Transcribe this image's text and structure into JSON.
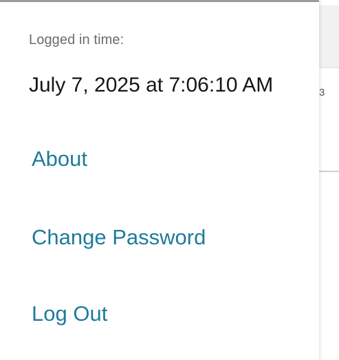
{
  "background": {
    "partial_glyph": "3"
  },
  "user_menu": {
    "login_label": "Logged in time:",
    "login_time": "July 7, 2025 at 7:06:10 AM",
    "items": [
      {
        "label": "About"
      },
      {
        "label": "Change Password"
      },
      {
        "label": "Log Out"
      }
    ]
  },
  "colors": {
    "link": "#1f7a9c",
    "label": "#6b6b6b",
    "text": "#161513"
  }
}
